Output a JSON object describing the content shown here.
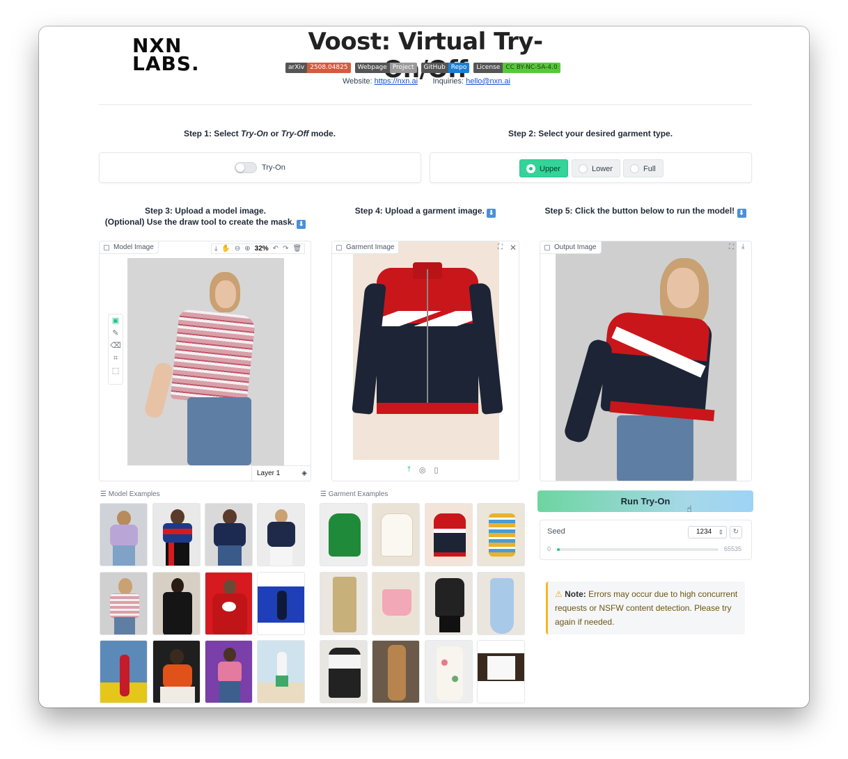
{
  "header": {
    "logo_line1": "NXN",
    "logo_line2": "LABS.",
    "title": "Voost: Virtual Try-On/Off",
    "badges": [
      {
        "left": "arXiv",
        "right": "2508.04825",
        "right_color": "#d7593e"
      },
      {
        "left": "Webpage",
        "right": "Project",
        "right_color": "#9a9a9a"
      },
      {
        "left": "GitHub",
        "right": "Repo",
        "right_color": "#1b7fd3"
      },
      {
        "left": "License",
        "right": "CC BY-NC-SA-4.0",
        "right_color": "#58c83b"
      }
    ],
    "website_label": "Website:",
    "website_link": "https://nxn.ai",
    "inquiries_label": "Inquiries:",
    "inquiries_link": "hello@nxn.ai"
  },
  "step1": {
    "prefix": "Step 1: Select ",
    "try_on": "Try-On",
    "or": " or ",
    "try_off": "Try-Off",
    "suffix": " mode.",
    "toggle_label": "Try-On"
  },
  "step2": {
    "text": "Step 2: Select your desired garment type.",
    "options": [
      "Upper",
      "Lower",
      "Full"
    ],
    "selected": "Upper"
  },
  "step3": {
    "line1": "Step 3: Upload a model image.",
    "line2": "(Optional) Use the draw tool to create the mask.",
    "box_label": "Model Image",
    "zoom": "32%",
    "layer": "Layer 1"
  },
  "step4": {
    "text": "Step 4: Upload a garment image.",
    "box_label": "Garment Image"
  },
  "step5": {
    "text": "Step 5: Click the button below to run the model!",
    "box_label": "Output Image"
  },
  "examples": {
    "model_label": "Model Examples",
    "garment_label": "Garment Examples"
  },
  "run_button": "Run Try-On",
  "seed": {
    "label": "Seed",
    "value": "1234",
    "min": "0",
    "max": "65535",
    "slider_fraction": 0.019
  },
  "note": {
    "bold": "Note:",
    "text": " Errors may occur due to high concurrent requests or NSFW content detection. Please try again if needed."
  },
  "colors": {
    "accent_green": "#34d399",
    "jacket_red": "#c9161b",
    "jacket_navy": "#1c2436"
  }
}
